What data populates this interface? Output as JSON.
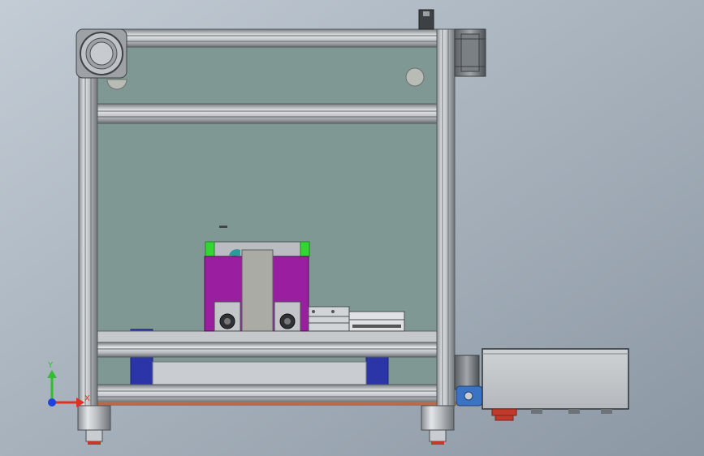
{
  "view": {
    "background_top": "#b8c2cc",
    "background_bottom": "#8f9aa6"
  },
  "triad": {
    "y_label": "Y",
    "x_label": "X",
    "y_color": "#2fbf2f",
    "x_color": "#e03020",
    "z_color": "#2040e0"
  },
  "colors": {
    "panel": "#7f9893",
    "profile": "#c9ccd0",
    "profile_dark": "#6e7378",
    "drive_frame": "#9a1fa0",
    "green_block": "#33d633",
    "blue_block": "#2b35a8",
    "control_box": "#c4c7cb",
    "bracket_blue": "#3a72c4",
    "foot_red": "#c0392b"
  },
  "parts": [
    "frame-left-post",
    "frame-right-post",
    "frame-top-beam",
    "frame-mid-beam",
    "frame-lower-beam",
    "frame-bottom-beam",
    "back-panel",
    "pulley-top-left",
    "motor-top-right",
    "drive-unit",
    "linear-slide",
    "base-plate",
    "support-blocks",
    "control-box",
    "feet"
  ]
}
